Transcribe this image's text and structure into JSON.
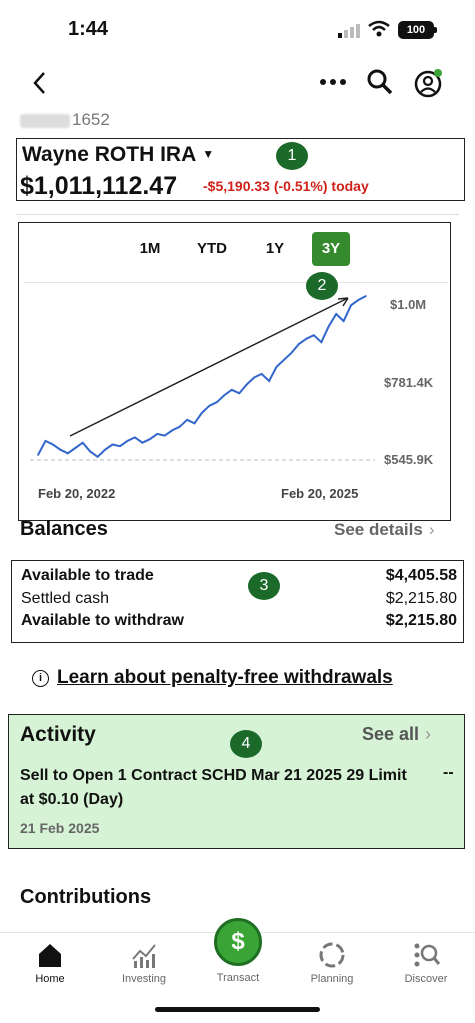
{
  "status_bar": {
    "time": "1:44",
    "battery": "100"
  },
  "account": {
    "number_suffix": "1652",
    "name": "Wayne ROTH IRA",
    "balance": "$1,011,112.47",
    "change_today": "-$5,190.33 (-0.51%) today"
  },
  "annotations": [
    "1",
    "2",
    "3",
    "4"
  ],
  "chart": {
    "ranges": [
      "1M",
      "YTD",
      "1Y",
      "3Y"
    ],
    "selected_range": "3Y"
  },
  "chart_data": {
    "type": "line",
    "x_labels": [
      "Feb 20, 2022",
      "Feb 20, 2025"
    ],
    "y_tick_labels": [
      "$1.0M",
      "$781.4K",
      "$545.9K"
    ],
    "ylim": [
      545900,
      1011112
    ],
    "series_color": "#3366cc",
    "values": [
      560000,
      600000,
      590000,
      575000,
      565000,
      580000,
      595000,
      570000,
      555000,
      575000,
      590000,
      585000,
      600000,
      610000,
      595000,
      605000,
      620000,
      615000,
      630000,
      640000,
      660000,
      650000,
      680000,
      700000,
      710000,
      730000,
      745000,
      735000,
      760000,
      780000,
      790000,
      770000,
      810000,
      830000,
      850000,
      875000,
      890000,
      900000,
      880000,
      925000,
      960000,
      940000,
      985000,
      1000000,
      1011112
    ]
  },
  "balances": {
    "title": "Balances",
    "see_details": "See details",
    "rows": [
      {
        "label": "Available to trade",
        "value": "$4,405.58"
      },
      {
        "label": "Settled cash",
        "value": "$2,215.80"
      },
      {
        "label": "Available to withdraw",
        "value": "$2,215.80"
      }
    ]
  },
  "learn_link": "Learn about penalty-free withdrawals",
  "activity": {
    "title": "Activity",
    "see_all": "See all",
    "item_desc": "Sell to Open  1 Contract SCHD Mar 21 2025 29 Limit at $0.10 (Day)",
    "item_value": "--",
    "item_date": "21 Feb 2025"
  },
  "contributions_title": "Contributions",
  "tabs": {
    "home": "Home",
    "investing": "Investing",
    "transact": "Transact",
    "planning": "Planning",
    "discover": "Discover"
  },
  "colors": {
    "accent_green": "#368a2e",
    "negative": "#d0211b",
    "highlight": "#d6f3d6"
  }
}
